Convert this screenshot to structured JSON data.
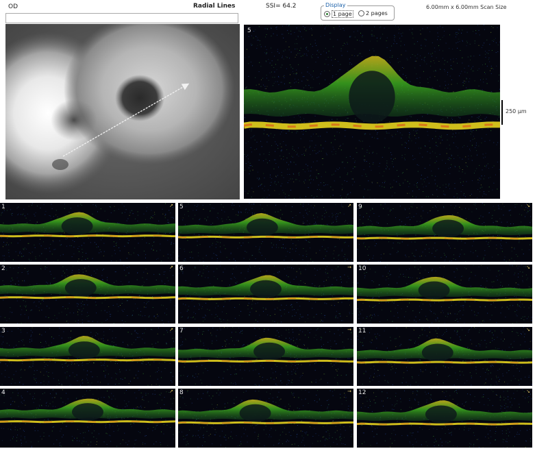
{
  "header": {
    "eye": "OD",
    "protocol": "Radial Lines",
    "ssi": "SSI= 64.2",
    "scan_size": "6.00mm x 6.00mm Scan Size"
  },
  "display": {
    "legend": "Display",
    "option_1": "1 page",
    "option_2": "2 pages",
    "selected": "1 page"
  },
  "main_scan": {
    "number": "5",
    "scale_label": "250 µm"
  },
  "thumbnails": [
    {
      "number": "1",
      "arrow": "↗"
    },
    {
      "number": "5",
      "arrow": "↗"
    },
    {
      "number": "9",
      "arrow": "↘"
    },
    {
      "number": "2",
      "arrow": "↗"
    },
    {
      "number": "6",
      "arrow": "→"
    },
    {
      "number": "10",
      "arrow": "↘"
    },
    {
      "number": "3",
      "arrow": "↗"
    },
    {
      "number": "7",
      "arrow": "→"
    },
    {
      "number": "11",
      "arrow": "↘"
    },
    {
      "number": "4",
      "arrow": "↗"
    },
    {
      "number": "8",
      "arrow": "→"
    },
    {
      "number": "12",
      "arrow": "↘"
    }
  ],
  "icons": {
    "radio_selected": "radio-selected-icon",
    "radio_unselected": "radio-unselected-icon",
    "scan_direction": "arrow-icon"
  },
  "colors": {
    "scan_background": "#05060f",
    "retina_green": "#3fb21f",
    "retina_yellow": "#e6d21e",
    "retina_red": "#e0401a",
    "fundus_gray": "#5d5d5d"
  }
}
